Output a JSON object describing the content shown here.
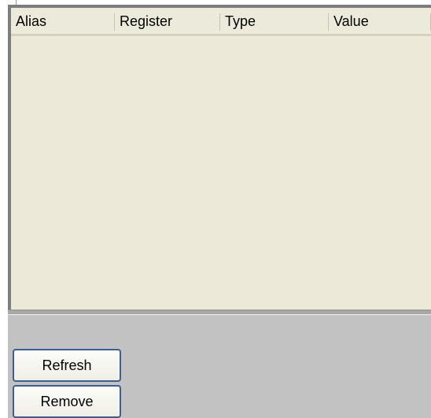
{
  "table": {
    "columns": [
      {
        "label": "Alias"
      },
      {
        "label": "Register"
      },
      {
        "label": "Type"
      },
      {
        "label": "Value"
      }
    ],
    "rows": []
  },
  "buttons": {
    "refresh_label": "Refresh",
    "remove_label": "Remove"
  },
  "colors": {
    "table_background": "#ece9d8",
    "panel_background": "#c2c2c2",
    "button_border": "#3c5e90"
  }
}
